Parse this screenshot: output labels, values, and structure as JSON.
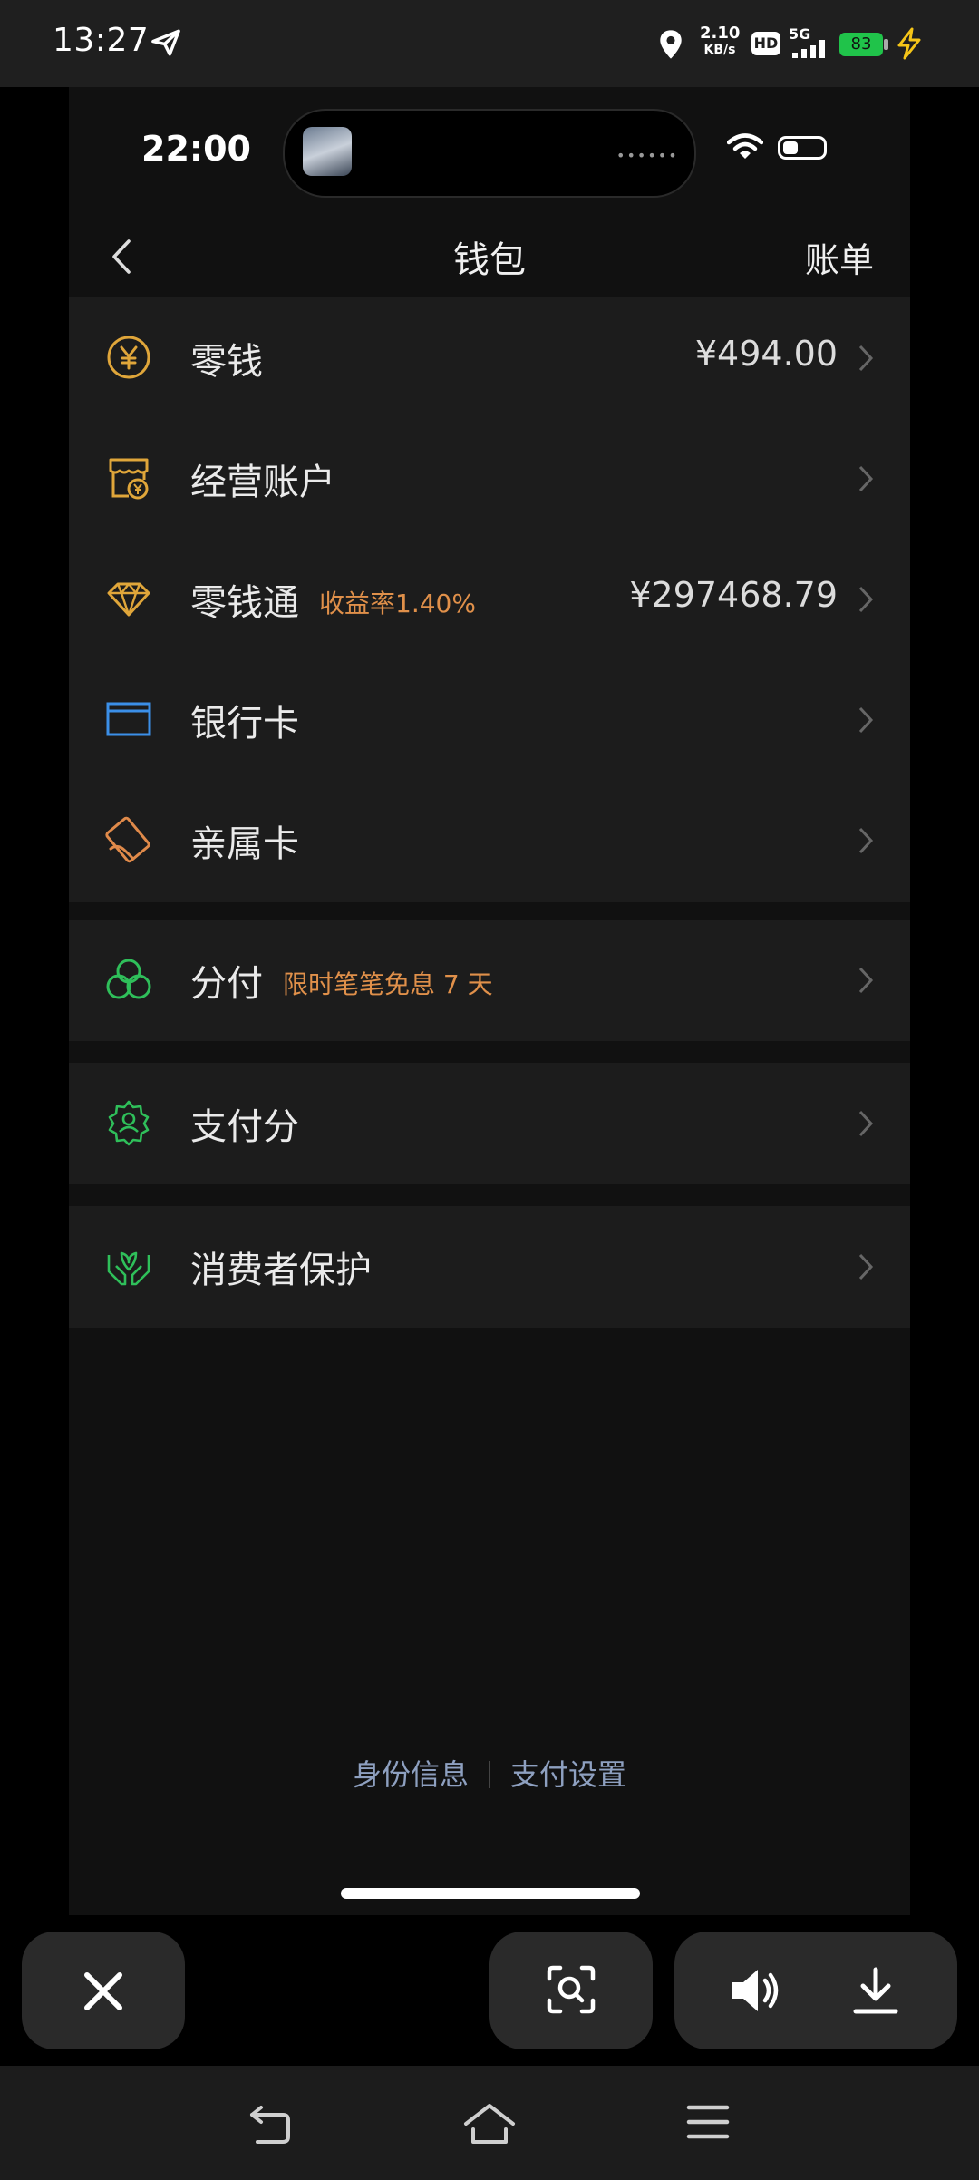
{
  "system_status": {
    "time": "13:27",
    "net_speed_value": "2.10",
    "net_speed_unit": "KB/s",
    "hd": "HD",
    "network": "5G",
    "battery": "83"
  },
  "inner_status": {
    "time": "22:00"
  },
  "navbar": {
    "title": "钱包",
    "bill": "账单"
  },
  "wallet_items": [
    {
      "label": "零钱",
      "value": "¥494.00",
      "icon": "yuan-coin-icon"
    },
    {
      "label": "经营账户",
      "value": "",
      "icon": "shop-account-icon"
    },
    {
      "label": "零钱通",
      "tag": "收益率1.40%",
      "value": "¥297468.79",
      "icon": "diamond-icon"
    },
    {
      "label": "银行卡",
      "value": "",
      "icon": "bank-card-icon"
    },
    {
      "label": "亲属卡",
      "value": "",
      "icon": "family-card-icon"
    }
  ],
  "fenfu": {
    "label": "分付",
    "tag": "限时笔笔免息 7 天",
    "icon": "fenfu-icon"
  },
  "zhifufen": {
    "label": "支付分",
    "icon": "pay-score-icon"
  },
  "consumer": {
    "label": "消费者保护",
    "icon": "consumer-protection-icon"
  },
  "footer": {
    "identity": "身份信息",
    "pay_settings": "支付设置"
  },
  "colors": {
    "gold": "#e0a63a",
    "orange": "#e0904a",
    "blue": "#3b8fe8",
    "green": "#2fbf5a",
    "link": "#8ea0c0"
  }
}
